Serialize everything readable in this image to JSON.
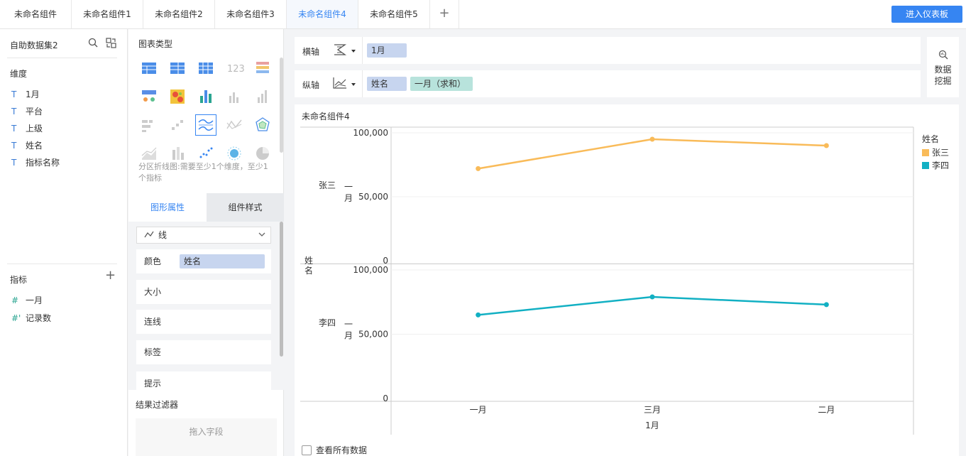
{
  "tabs": [
    {
      "label": "未命名组件",
      "active": false
    },
    {
      "label": "未命名组件1",
      "active": false
    },
    {
      "label": "未命名组件2",
      "active": false
    },
    {
      "label": "未命名组件3",
      "active": false
    },
    {
      "label": "未命名组件4",
      "active": true
    },
    {
      "label": "未命名组件5",
      "active": false
    }
  ],
  "tab_add": "+",
  "enter_dashboard": "进入仪表板",
  "dataset": {
    "title": "自助数据集2",
    "dimension_label": "维度",
    "dimensions": [
      "1月",
      "平台",
      "上级",
      "姓名",
      "指标名称"
    ],
    "measure_label": "指标",
    "measures": [
      "一月",
      "记录数"
    ],
    "dim_type_glyph": "T",
    "measure_type_glyph": "#",
    "measure_calc_glyph": "#'"
  },
  "chart_types": {
    "title": "图表类型",
    "hint": "分区折线图:需要至少1个维度，至少1个指标"
  },
  "props": {
    "tab_shape": "图形属性",
    "tab_style": "组件样式",
    "mark_type": "线",
    "color_label": "颜色",
    "color_field": "姓名",
    "size_label": "大小",
    "connect_label": "连线",
    "tag_label": "标签",
    "tip_label": "提示"
  },
  "filter": {
    "title": "结果过滤器",
    "drop_hint": "拖入字段"
  },
  "axes": {
    "x_label": "横轴",
    "x_fields": [
      "1月"
    ],
    "y_label": "纵轴",
    "y_fields": [
      "姓名",
      "一月（求和）"
    ]
  },
  "mining": {
    "line1": "数据",
    "line2": "挖掘"
  },
  "chart": {
    "title": "未命名组件4",
    "view_all": "查看所有数据"
  },
  "colors": {
    "accent": "#3685f2",
    "series_zhangsan": "#f9bb59",
    "series_lisi": "#12b0c3",
    "chip_dim": "#c7d5ef",
    "chip_measure": "#b8e3dc"
  },
  "chart_data": {
    "type": "line",
    "categories": [
      "一月",
      "三月",
      "二月"
    ],
    "xlabel": "1月",
    "ylabel": "姓名",
    "panel_ylabel": "一月",
    "ylim": [
      0,
      100000
    ],
    "yticks": [
      "0",
      "50,000",
      "100,000"
    ],
    "legend_title": "姓名",
    "legend_placement": "top-right",
    "series": [
      {
        "name": "张三",
        "values": [
          72000,
          95000,
          90000
        ]
      },
      {
        "name": "李四",
        "values": [
          65000,
          79000,
          73000
        ]
      }
    ]
  }
}
